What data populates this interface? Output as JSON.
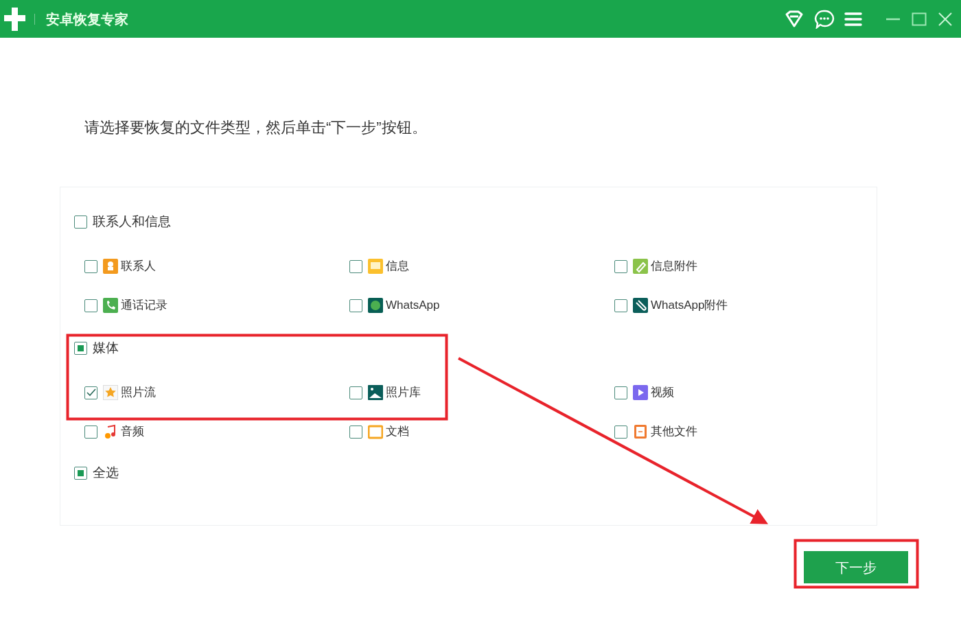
{
  "window": {
    "title": "安卓恢复专家"
  },
  "instruction": "请选择要恢复的文件类型，然后单击“下一步”按钮。",
  "groups": [
    {
      "label": "联系人和信息",
      "partial": false,
      "items": [
        {
          "label": "联系人",
          "checked": false
        },
        {
          "label": "信息",
          "checked": false
        },
        {
          "label": "信息附件",
          "checked": false
        },
        {
          "label": "通话记录",
          "checked": false
        },
        {
          "label": "WhatsApp",
          "checked": false
        },
        {
          "label": "WhatsApp附件",
          "checked": false
        }
      ]
    },
    {
      "label": "媒体",
      "partial": true,
      "items": [
        {
          "label": "照片流",
          "checked": true
        },
        {
          "label": "照片库",
          "checked": false
        },
        {
          "label": "视频",
          "checked": false
        },
        {
          "label": "音频",
          "checked": false
        },
        {
          "label": "文档",
          "checked": false
        },
        {
          "label": "其他文件",
          "checked": false
        }
      ]
    }
  ],
  "select_all": {
    "label": "全选",
    "partial": true
  },
  "next_button": "下一步"
}
